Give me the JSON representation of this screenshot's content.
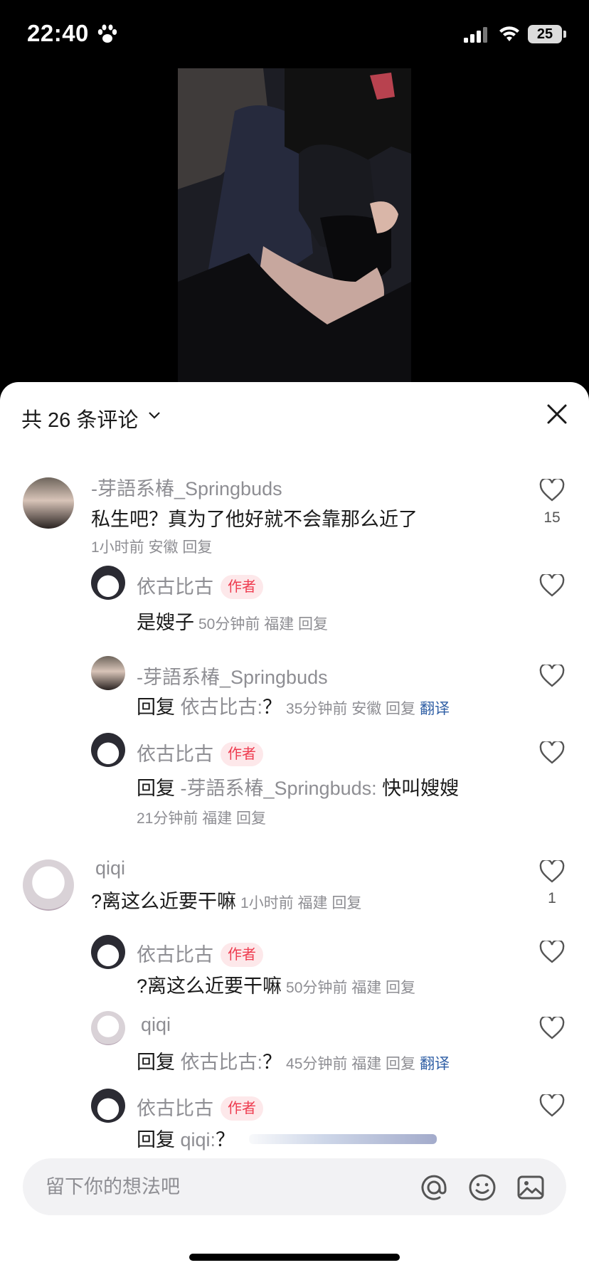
{
  "status_bar": {
    "time": "22:40",
    "battery": "25"
  },
  "sheet": {
    "title": "共 26 条评论",
    "close_label": "close"
  },
  "comments": [
    {
      "user": "-芽語系椿_Springbuds",
      "text": "私生吧？真为了他好就不会靠那么近了",
      "meta": "1小时前 安徽 回复",
      "likes": "15",
      "replies": [
        {
          "user": "依古比古",
          "tag": "作者",
          "text": "是嫂子",
          "meta": "50分钟前 福建 回复"
        },
        {
          "user": "-芽語系椿_Springbuds",
          "prefix": "回复",
          "reply_to": "依古比古:",
          "text": "？",
          "meta": "35分钟前 安徽 回复",
          "translate": "翻译"
        },
        {
          "user": "依古比古",
          "tag": "作者",
          "prefix": "回复",
          "reply_to": "-芽語系椿_Springbuds:",
          "text": "快叫嫂嫂",
          "meta": "21分钟前 福建 回复"
        }
      ]
    },
    {
      "user": "qiqi",
      "text": "?离这么近要干嘛",
      "meta": "1小时前 福建 回复",
      "likes": "1",
      "replies": [
        {
          "user": "依古比古",
          "tag": "作者",
          "text": "?离这么近要干嘛",
          "meta": "50分钟前 福建 回复"
        },
        {
          "user": "qiqi",
          "prefix": "回复",
          "reply_to": "依古比古:",
          "text": "？",
          "meta": "45分钟前 福建 回复",
          "translate": "翻译"
        },
        {
          "user": "依古比古",
          "tag": "作者",
          "prefix": "回复",
          "reply_to": "qiqi:",
          "text": "？"
        }
      ]
    }
  ],
  "input": {
    "placeholder": "留下你的想法吧"
  },
  "icons": [
    "paw-icon",
    "signal-icon",
    "wifi-icon",
    "chevron-down-icon",
    "close-icon",
    "heart-icon",
    "at-icon",
    "emoji-icon",
    "image-icon"
  ]
}
